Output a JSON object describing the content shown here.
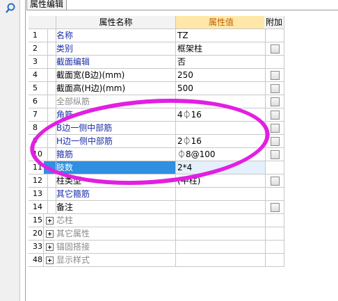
{
  "tab": {
    "label": "属性编辑"
  },
  "header": {
    "name": "属性名称",
    "value": "属性值",
    "extra": "附加"
  },
  "rows": [
    {
      "num": "1",
      "name": "名称",
      "value": "TZ",
      "check": false,
      "style": "blue"
    },
    {
      "num": "2",
      "name": "类别",
      "value": "框架柱",
      "check": true,
      "style": "blue"
    },
    {
      "num": "3",
      "name": "截面编辑",
      "value": "否",
      "check": false,
      "style": "blue"
    },
    {
      "num": "4",
      "name": "截面宽(B边)(mm)",
      "value": "250",
      "check": true,
      "style": ""
    },
    {
      "num": "5",
      "name": "截面高(H边)(mm)",
      "value": "500",
      "check": true,
      "style": ""
    },
    {
      "num": "6",
      "name": "全部纵筋",
      "value": "",
      "check": true,
      "style": "gray"
    },
    {
      "num": "7",
      "name": "角筋",
      "value": "4⏀16",
      "check": true,
      "style": "blue"
    },
    {
      "num": "8",
      "name": "B边一侧中部筋",
      "value": "",
      "check": true,
      "style": "blue"
    },
    {
      "num": "9",
      "name": "H边一侧中部筋",
      "value": "2⏀16",
      "check": true,
      "style": "blue"
    },
    {
      "num": "10",
      "name": "箍筋",
      "value": "⏀8@100",
      "check": true,
      "style": "blue"
    },
    {
      "num": "11",
      "name": "肢数",
      "value": "2*4",
      "check": false,
      "style": "sel"
    },
    {
      "num": "12",
      "name": "柱类型",
      "value": "(中柱)",
      "check": true,
      "style": ""
    },
    {
      "num": "13",
      "name": "其它箍筋",
      "value": "",
      "check": false,
      "style": "blue"
    },
    {
      "num": "14",
      "name": "备注",
      "value": "",
      "check": true,
      "style": ""
    }
  ],
  "groups": [
    {
      "num": "15",
      "name": "芯柱"
    },
    {
      "num": "20",
      "name": "其它属性"
    },
    {
      "num": "33",
      "name": "锚固搭接"
    },
    {
      "num": "48",
      "name": "显示样式"
    }
  ],
  "annotation_color": "#e21fe2"
}
